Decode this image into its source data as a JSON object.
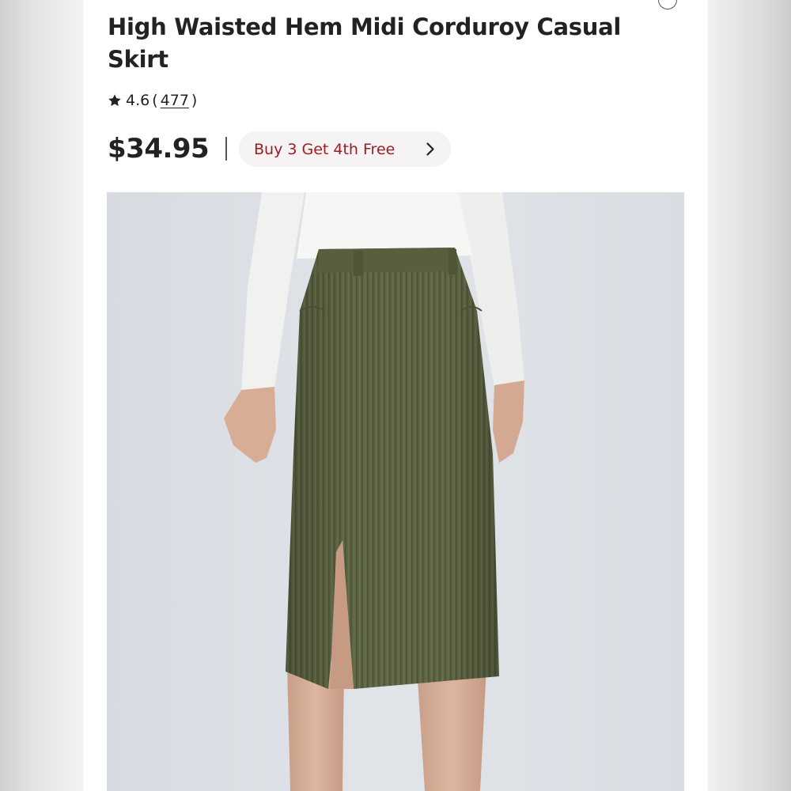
{
  "product": {
    "title": "High Waisted Hem Midi Corduroy Casual Skirt",
    "rating": "4.6",
    "paren_open": "(",
    "review_count": "477",
    "paren_close": ")",
    "price": "$34.95",
    "promo_label": "Buy 3 Get 4th Free",
    "image_description": "model wearing olive green corduroy midi skirt with front slit and white long-sleeve top"
  },
  "icons": {
    "rating": "star-icon",
    "promo": "chevron-right-icon",
    "corner": "circle-icon"
  },
  "colors": {
    "text": "#222222",
    "promo_text": "#9e1b1f",
    "promo_background": "#f5f3f3",
    "image_background": "#dde0e5",
    "skirt": "#5e6543",
    "top": "#f4f4f2",
    "skin": "#d9b29b"
  }
}
